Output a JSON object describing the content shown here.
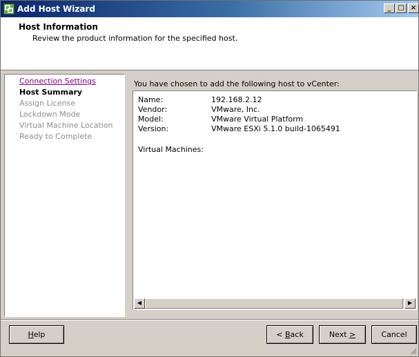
{
  "window": {
    "title": "Add Host Wizard"
  },
  "titlebar_buttons": {
    "minimize": "_",
    "maximize": "□",
    "close": "×"
  },
  "header": {
    "title": "Host Information",
    "description": "Review the product information for the specified host."
  },
  "steps": [
    {
      "label": "Connection Settings",
      "state": "visited"
    },
    {
      "label": "Host Summary",
      "state": "current"
    },
    {
      "label": "Assign License",
      "state": "disabled"
    },
    {
      "label": "Lockdown Mode",
      "state": "disabled"
    },
    {
      "label": "Virtual Machine Location",
      "state": "disabled"
    },
    {
      "label": "Ready to Complete",
      "state": "disabled"
    }
  ],
  "main": {
    "intro": "You have chosen to add the following host to vCenter:",
    "rows": [
      {
        "label": "Name:",
        "value": "192.168.2.12"
      },
      {
        "label": "Vendor:",
        "value": "VMware, Inc."
      },
      {
        "label": "Model:",
        "value": "VMware Virtual Platform"
      },
      {
        "label": "Version:",
        "value": "VMware ESXi 5.1.0 build-1065491"
      }
    ],
    "vm_label": "Virtual Machines:"
  },
  "buttons": {
    "help": {
      "mnemonic": "H",
      "rest": "elp"
    },
    "back": {
      "prefix": "< ",
      "mnemonic": "B",
      "rest": "ack"
    },
    "next": {
      "prefix": "Next ",
      "mnemonic": ">"
    },
    "cancel": "Cancel"
  },
  "colors": {
    "title_start": "#0a246a",
    "title_end": "#a6caf0",
    "visited_link": "#800080",
    "disabled": "#8c8c8c"
  },
  "icons": [
    "vsphere-app-icon",
    "minimize-icon",
    "maximize-icon",
    "close-icon",
    "scroll-left-icon",
    "scroll-right-icon",
    "resize-grip-icon"
  ]
}
